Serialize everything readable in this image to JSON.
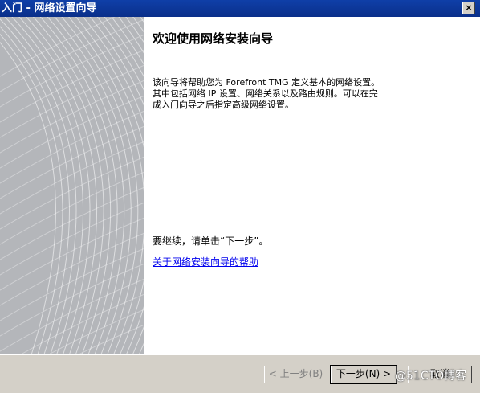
{
  "window": {
    "title": "入门 - 网络设置向导",
    "close_glyph": "×"
  },
  "page": {
    "heading": "欢迎使用网络安装向导",
    "intro": "该向导将帮助您为 Forefront TMG 定义基本的网络设置。\n其中包括网络 IP 设置、网络关系以及路由规则。可以在完\n成入门向导之后指定高级网络设置。",
    "continue_text": "要继续，请单击“下一步”。",
    "help_link": "关于网络安装向导的帮助"
  },
  "buttons": {
    "back": "< 上一步(B)",
    "next": "下一步(N) >",
    "cancel": "取消"
  },
  "watermark": "@51CTO博客",
  "colors": {
    "titlebar": "#0a2f8a",
    "side_panel": "#b4b6ba",
    "link": "#0000ee",
    "dialog_face": "#d4d0c8"
  }
}
